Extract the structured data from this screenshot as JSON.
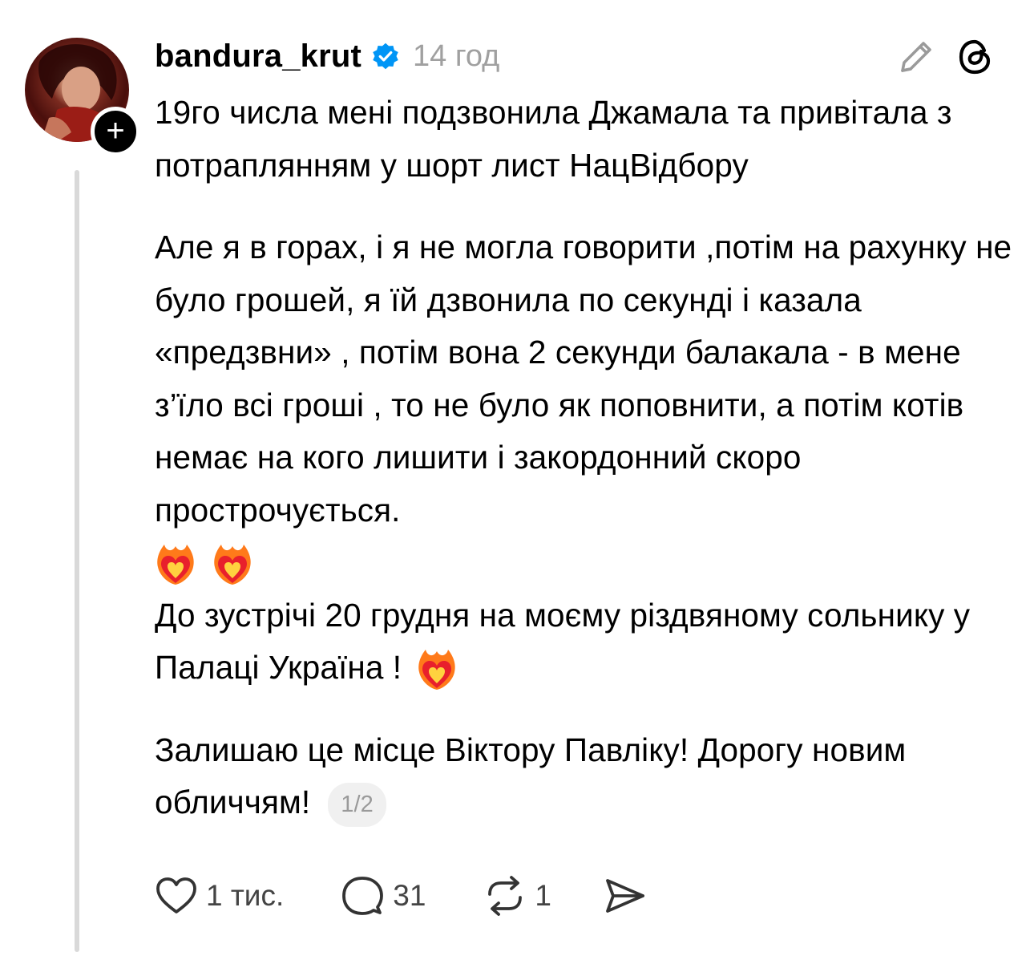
{
  "post": {
    "username": "bandura_krut",
    "time": "14 год",
    "follow_symbol": "+",
    "paragraphs": {
      "p1": "19го числа мені подзвонила Джамала та привітала з потраплянням у шорт лист НацВідбору",
      "p2": "Але я в горах, і я не могла  говорити ,потім на рахунку не було грошей, я їй дзвонила по секунді і казала «предзвни» , потім вона 2 секунди балакала - в мене з’їло всі гроші , то не було як поповнити, а потім котів немає на кого лишити і закордонний скоро прострочується.",
      "p3": "До зустрічі 20 грудня на моєму різдвяному сольнику у Палаці Україна !",
      "p4": "Залишаю це місце Віктору Павліку! Дорогу новим обличчям!"
    },
    "pager": "1/2"
  },
  "actions": {
    "likes": "1 тис.",
    "comments": "31",
    "reposts": "1"
  },
  "icons": {
    "verified": "verified-badge-icon",
    "edit": "pencil-icon",
    "app": "threads-icon",
    "like": "heart-icon",
    "comment": "speech-bubble-icon",
    "repost": "repost-icon",
    "share": "send-icon",
    "emoji": "heart-on-fire-emoji"
  },
  "colors": {
    "verified": "#0095f6",
    "muted": "#a0a0a0",
    "thread_line": "#d9d9d9"
  }
}
